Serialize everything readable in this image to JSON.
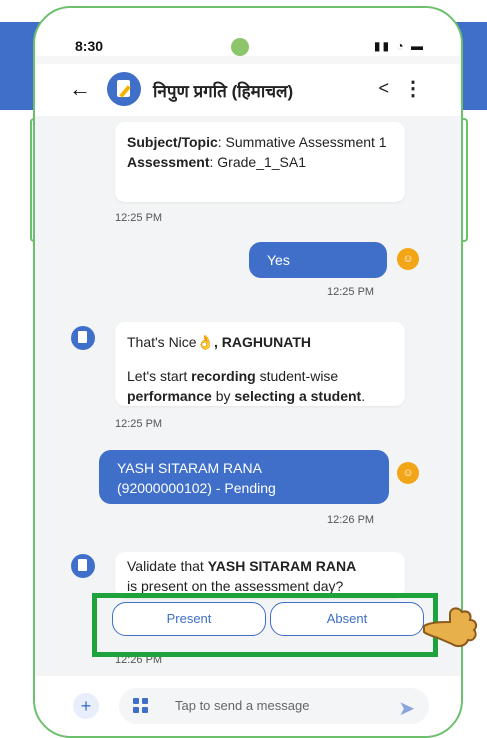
{
  "status": {
    "time": "8:30",
    "icons": "◂◂ ◔ ▬"
  },
  "header": {
    "back": "←",
    "title": "निपुण प्रगति (हिमाचल)",
    "share": "<",
    "more": "⋮"
  },
  "messages": {
    "m1": {
      "subject_label": "Subject/Topic",
      "subject_value": ": Summative Assessment 1",
      "assessment_label": "Assessment",
      "assessment_value": ": Grade_1_SA1",
      "time": "12:25 PM"
    },
    "m2": {
      "text": "Yes",
      "time": "12:25 PM"
    },
    "m3": {
      "greet": "That's Nice",
      "emoji": "👌",
      "name": ", RAGHUNATH",
      "l1": "Let's start ",
      "b1": "recording",
      "l2": " student-wise",
      "b2": "performance",
      "l3": " by ",
      "b3": "selecting a student",
      "l4": ".",
      "time": "12:25 PM"
    },
    "m4": {
      "line1": "YASH SITARAM RANA",
      "line2": "(92000000102) - Pending",
      "time": "12:26 PM"
    },
    "m5": {
      "l1": "Validate that ",
      "b1": "YASH SITARAM RANA",
      "l2": "is present on the assessment day?",
      "time": "12:26 PM"
    }
  },
  "actions": {
    "present": "Present",
    "absent": "Absent"
  },
  "composer": {
    "plus": "+",
    "placeholder": "Tap to send a message",
    "send": "➤"
  },
  "colors": {
    "brand": "#3f6fc8",
    "highlight": "#1ea23b",
    "user_avatar": "#f2a516",
    "frame": "#6cc06b"
  }
}
